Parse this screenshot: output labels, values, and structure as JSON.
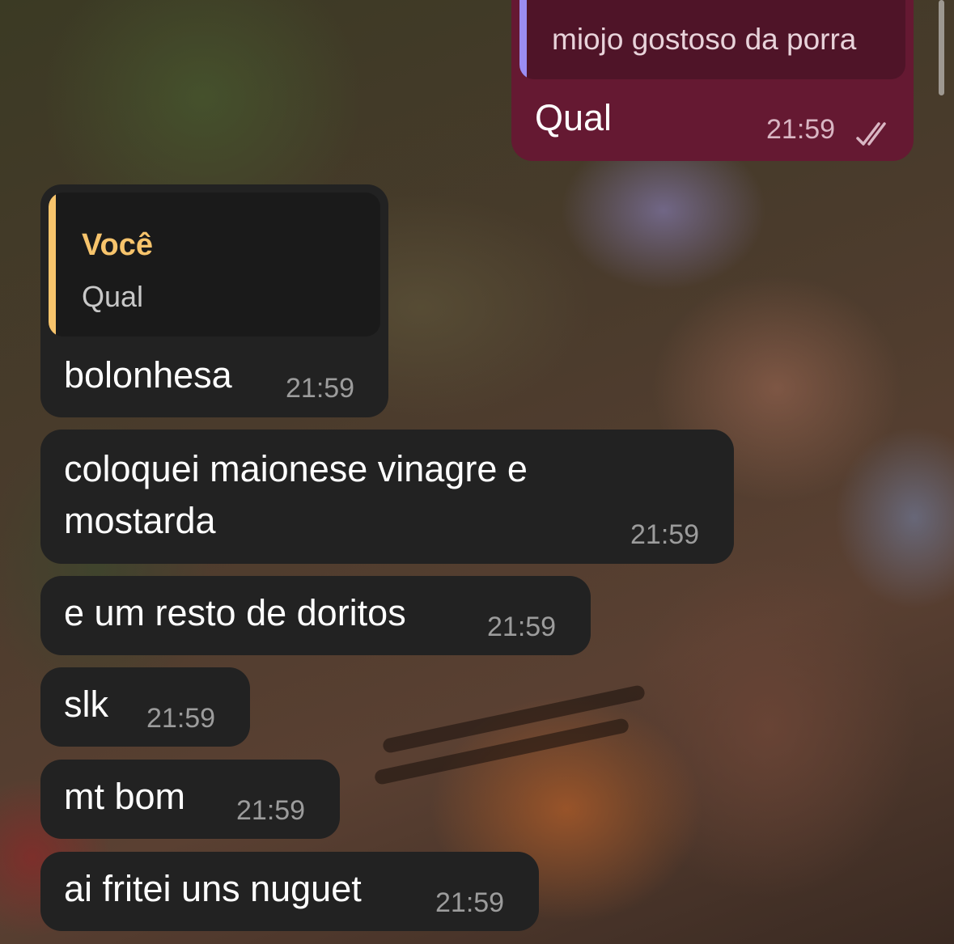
{
  "colors": {
    "incoming_bubble": "#222222",
    "outgoing_bubble": "#651932",
    "outgoing_quote_bg": "#4f1428",
    "outgoing_quote_bar": "#9b8df2",
    "incoming_quote_bg": "#1a1a1a",
    "incoming_quote_bar": "#f7c46c",
    "incoming_quote_author": "#f7c46c",
    "timestamp": "#9c9c9c"
  },
  "messages": [
    {
      "direction": "outgoing",
      "quote": {
        "text": "miojo gostoso da porra"
      },
      "text": "Qual",
      "time": "21:59",
      "status_icon": "double-check-icon"
    },
    {
      "direction": "incoming",
      "quote": {
        "author": "Você",
        "text": "Qual"
      },
      "text": "bolonhesa",
      "time": "21:59"
    },
    {
      "direction": "incoming",
      "lines": [
        "coloquei maionese vinagre e",
        "mostarda"
      ],
      "time": "21:59"
    },
    {
      "direction": "incoming",
      "text": "e um resto de doritos",
      "time": "21:59"
    },
    {
      "direction": "incoming",
      "text": "slk",
      "time": "21:59"
    },
    {
      "direction": "incoming",
      "text": "mt bom",
      "time": "21:59"
    },
    {
      "direction": "incoming",
      "text": "ai fritei uns nuguet",
      "time": "21:59"
    }
  ]
}
